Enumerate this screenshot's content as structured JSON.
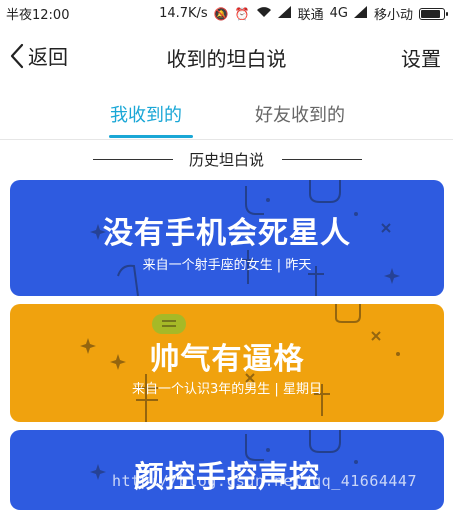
{
  "status_bar": {
    "time": "半夜12:00",
    "speed": "14.7K/s",
    "carrier": "联通",
    "network": "4G",
    "mobile": "移小动",
    "battery_level": 0.8
  },
  "header": {
    "back_label": "返回",
    "title": "收到的坦白说",
    "settings_label": "设置"
  },
  "tabs": [
    {
      "label": "我收到的",
      "active": true
    },
    {
      "label": "好友收到的",
      "active": false
    }
  ],
  "section": {
    "label": "历史坦白说"
  },
  "cards": [
    {
      "message": "没有手机会死星人",
      "meta": "来自一个射手座的女生 | 昨天",
      "color": "#2e5be0"
    },
    {
      "message": "帅气有逼格",
      "meta": "来自一个认识3年的男生 | 星期日",
      "color": "#f0a20e"
    },
    {
      "message": "颜控手控声控",
      "meta": "",
      "color": "#2e5be0"
    }
  ],
  "watermark": "http://blog.csdn.net/qq_41664447",
  "colors": {
    "accent": "#1aa7d6",
    "blue_card": "#2e5be0",
    "orange_card": "#f0a20e"
  }
}
